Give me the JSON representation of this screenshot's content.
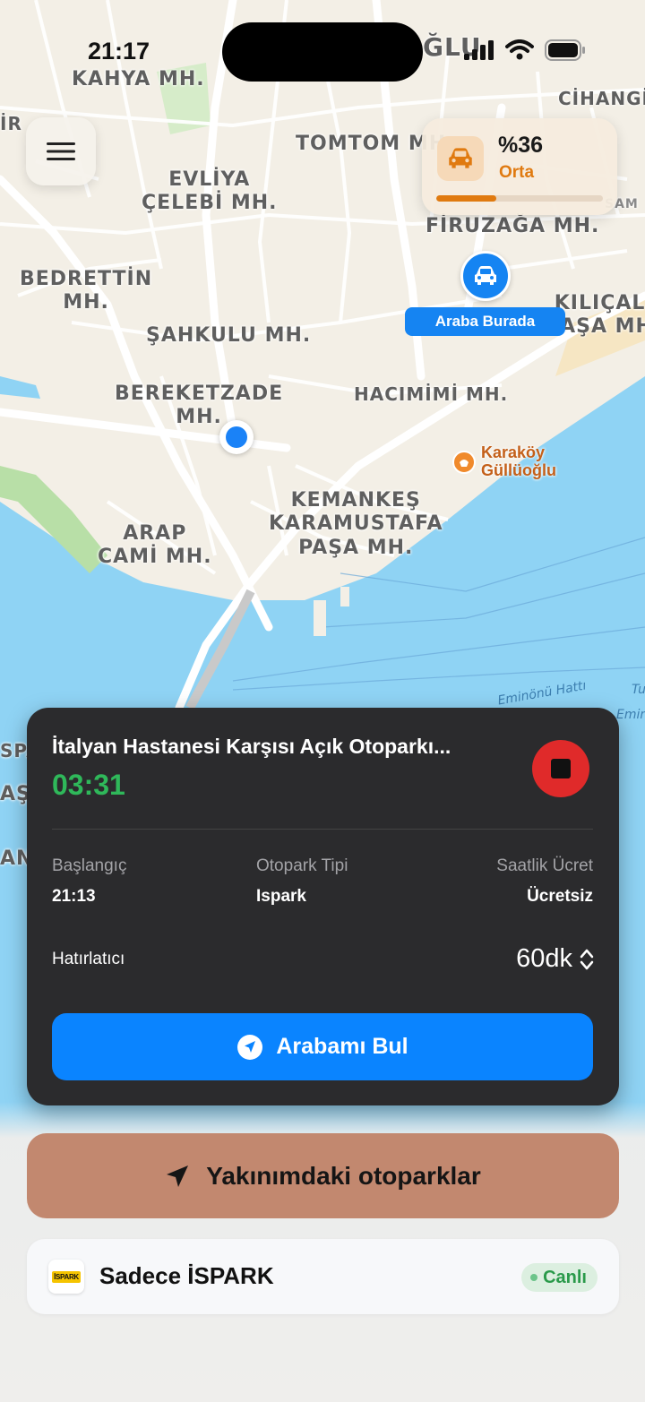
{
  "status_bar": {
    "time": "21:17"
  },
  "map": {
    "labels": {
      "kahya": "KAHYA MH.",
      "tomtom": "TOMTOM MH.",
      "evliya": "EVLİYA\nÇELEBİ MH.",
      "firuzaga": "FİRUZAĞA MH.",
      "bedrettin": "BEDRETTİN\nMH.",
      "sahkulu": "ŞAHKULU MH.",
      "kilicali": "KILIÇALİ\nPAŞA MH.",
      "bereketzade": "BEREKETZADE\nMH.",
      "hacimimi": "HACIMİMİ MH.",
      "kemankes": "KEMANKEŞ\nKARAMUSTAFA\nPAŞA MH.",
      "arap": "ARAP\nCAMİ MH.",
      "cihangir": "CİHANGİR",
      "beyoglu": "ĞLU",
      "ir": "İR",
      "spa": "SPA",
      "as": "AŞ",
      "an": "AN",
      "sam": "SAM"
    },
    "water_labels": {
      "eminonu": "Eminönü Hattı",
      "emin": "Emin",
      "tu": "Tu"
    },
    "poi": {
      "name_line1": "Karaköy",
      "name_line2": "Güllüoğlu"
    },
    "car_marker_label": "Araba Burada"
  },
  "car_card": {
    "percent": "%36",
    "level": "Orta",
    "fill_fraction": 0.36
  },
  "session": {
    "title": "İtalyan Hastanesi Karşısı Açık Otoparkı...",
    "timer": "03:31",
    "start_label": "Başlangıç",
    "start_value": "21:13",
    "type_label": "Otopark Tipi",
    "type_value": "Ispark",
    "fee_label": "Saatlik Ücret",
    "fee_value": "Ücretsiz",
    "reminder_label": "Hatırlatıcı",
    "reminder_value": "60dk",
    "find_button": "Arabamı Bul"
  },
  "nearby_button": "Yakınımdaki otoparklar",
  "filter": {
    "logo_text": "İSPARK",
    "label": "Sadece İSPARK",
    "badge": "Canlı"
  },
  "colors": {
    "accent_blue": "#0a84ff",
    "timer_green": "#2fb85a",
    "stop_red": "#e02a2a",
    "battery_orange": "#e07a10",
    "nearby_bg": "#c2886f",
    "water": "#8fd3f4",
    "land": "#f3efe6"
  },
  "icons": {
    "menu": "hamburger-icon",
    "car": "car-icon",
    "stop": "stop-icon",
    "navigate": "location-arrow-icon",
    "chevron": "chevron-updown-icon",
    "poi": "bakery-icon"
  }
}
